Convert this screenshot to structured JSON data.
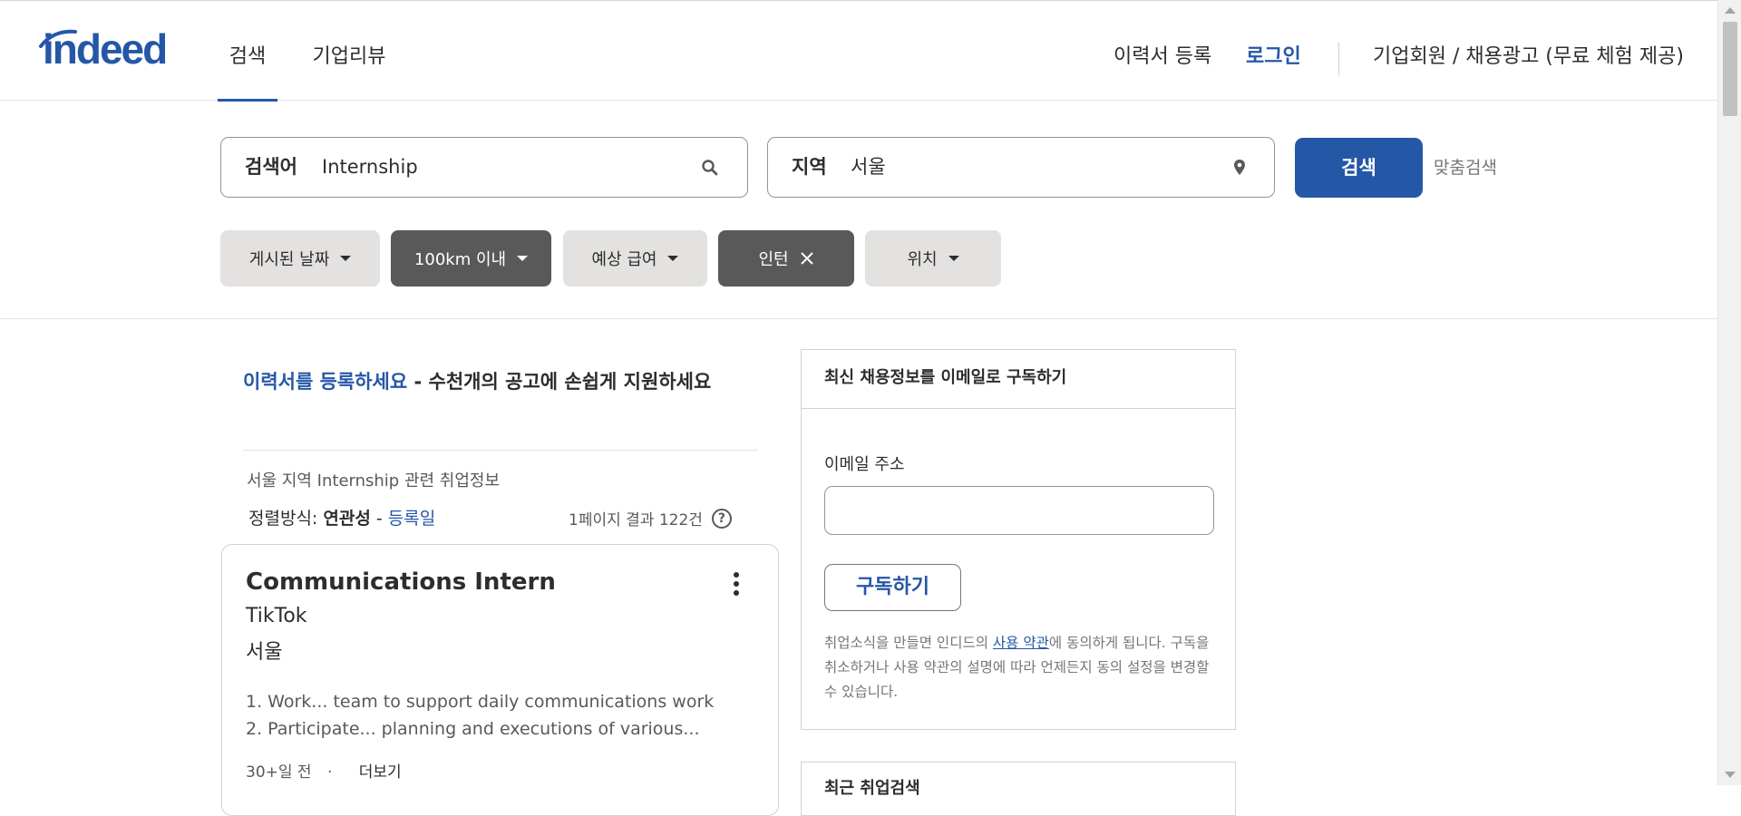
{
  "header": {
    "logo_text": "indeed",
    "tabs": [
      {
        "label": "검색",
        "active": true
      },
      {
        "label": "기업리뷰",
        "active": false
      }
    ],
    "resume_link": "이력서 등록",
    "login_link": "로그인",
    "employer_link": "기업회원 / 채용광고 (무료 체험 제공)"
  },
  "search": {
    "what_label": "검색어",
    "what_value": "Internship",
    "where_label": "지역",
    "where_value": "서울",
    "button_label": "검색",
    "advanced_link": "맞춤검색"
  },
  "filters": [
    {
      "label": "게시된 날짜",
      "active": false
    },
    {
      "label": "100km 이내",
      "active": true
    },
    {
      "label": "예상 급여",
      "active": false
    },
    {
      "label": "인턴",
      "active": true,
      "removable": true
    },
    {
      "label": "위치",
      "active": false
    }
  ],
  "promo": {
    "link_text": "이력서를 등록하세요",
    "rest_text": " - 수천개의 공고에 손쉽게 지원하세요"
  },
  "results": {
    "context": "서울 지역 Internship 관련 취업정보",
    "sort_label": "정렬방식:",
    "sort_active": "연관성",
    "sort_sep": "-",
    "sort_other": "등록일",
    "count": "1페이지 결과 122건"
  },
  "jobs": [
    {
      "title": "Communications Intern",
      "company": "TikTok",
      "location": "서울",
      "snippet": [
        "1. Work... team to support daily communications work",
        "2. Participate... planning and executions of various..."
      ],
      "posted": "30+일 전",
      "separator": "·",
      "more": "더보기"
    }
  ],
  "job_alert": {
    "heading": "최신 채용정보를 이메일로 구독하기",
    "email_label": "이메일 주소",
    "email_value": "",
    "subscribe_button": "구독하기",
    "terms_before": "취업소식을 만들면 인디드의 ",
    "terms_link": "사용 약관",
    "terms_after": "에 동의하게 됩니다. 구독을 취소하거나 사용 약관의 설명에 따라 언제든지 동의 설정을 변경할 수 있습니다."
  },
  "recent_searches": {
    "heading": "최근 취업검색"
  },
  "colors": {
    "brand_blue": "#2557a7",
    "chip_dark": "#595959",
    "chip_light": "#e4e2e0"
  }
}
